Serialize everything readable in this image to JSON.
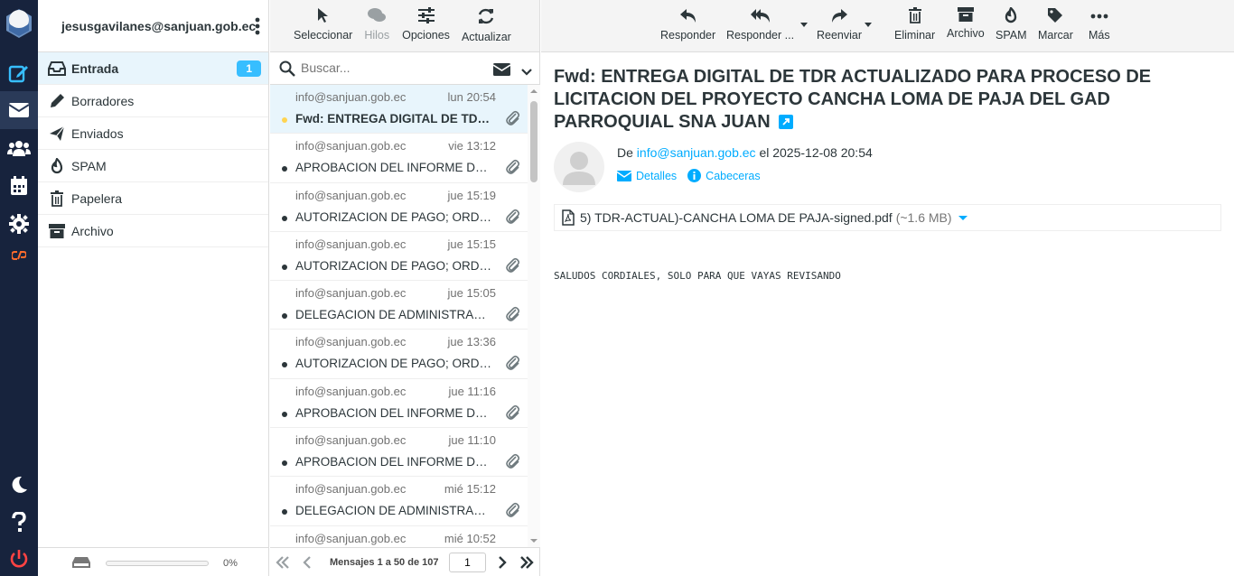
{
  "account": {
    "email": "jesusgavilanes@sanjuan.gob.ec"
  },
  "folders": [
    {
      "label": "Entrada",
      "badge": "1"
    },
    {
      "label": "Borradores"
    },
    {
      "label": "Enviados"
    },
    {
      "label": "SPAM"
    },
    {
      "label": "Papelera"
    },
    {
      "label": "Archivo"
    }
  ],
  "quota": {
    "percent_label": "0%",
    "percent": 0
  },
  "list_toolbar": {
    "select": "Seleccionar",
    "threads": "Hilos",
    "options": "Opciones",
    "refresh": "Actualizar"
  },
  "search": {
    "placeholder": "Buscar..."
  },
  "messages": [
    {
      "from": "info@sanjuan.gob.ec",
      "date": "lun 20:54",
      "subject": "Fwd: ENTREGA DIGITAL DE TDR ACTUALIZADO PARA PROCESO DE LICITACION"
    },
    {
      "from": "info@sanjuan.gob.ec",
      "date": "vie 13:12",
      "subject": "APROBACION DEL INFORME DE NECESIDAD"
    },
    {
      "from": "info@sanjuan.gob.ec",
      "date": "jue 15:19",
      "subject": "AUTORIZACION DE PAGO; ORDEN DE PAGO"
    },
    {
      "from": "info@sanjuan.gob.ec",
      "date": "jue 15:15",
      "subject": "AUTORIZACION DE PAGO; ORDEN DE PAGO"
    },
    {
      "from": "info@sanjuan.gob.ec",
      "date": "jue 15:05",
      "subject": "DELEGACION DE ADMINISTRADOR DE CONTRATO"
    },
    {
      "from": "info@sanjuan.gob.ec",
      "date": "jue 13:36",
      "subject": "AUTORIZACION DE PAGO; ORDEN DE PAGO"
    },
    {
      "from": "info@sanjuan.gob.ec",
      "date": "jue 11:16",
      "subject": "APROBACION DEL INFORME DE NECESIDAD"
    },
    {
      "from": "info@sanjuan.gob.ec",
      "date": "jue 11:10",
      "subject": "APROBACION DEL INFORME DE NECESIDAD"
    },
    {
      "from": "info@sanjuan.gob.ec",
      "date": "mié 15:12",
      "subject": "DELEGACION DE ADMINISTRADOR DE CONTRATO"
    },
    {
      "from": "info@sanjuan.gob.ec",
      "date": "mié 10:52",
      "subject": ""
    }
  ],
  "pager": {
    "count": "Mensajes 1 a 50 de 107",
    "page": "1"
  },
  "preview_toolbar": {
    "reply": "Responder",
    "reply_all": "Responder ...",
    "forward": "Reenviar",
    "delete": "Eliminar",
    "archive": "Archivo",
    "spam": "SPAM",
    "mark": "Marcar",
    "more": "Más"
  },
  "email": {
    "subject": "Fwd: ENTREGA DIGITAL DE TDR ACTUALIZADO PARA PROCESO DE LICITACION DEL PROYECTO CANCHA LOMA DE PAJA DEL GAD PARROQUIAL SNA JUAN",
    "from_prefix": "De",
    "from": "info@sanjuan.gob.ec",
    "date_prefix": "el",
    "date": "2025-12-08 20:54",
    "details_label": "Detalles",
    "headers_label": "Cabeceras",
    "attachment_name": "5) TDR-ACTUAL)-CANCHA LOMA DE PAJA-signed.pdf",
    "attachment_size": "(~1.6 MB)",
    "body": "SALUDOS CORDIALES, SOLO PARA QUE VAYAS REVISANDO"
  },
  "colors": {
    "rail": "#17233d",
    "accent": "#37beff",
    "link": "#00acff",
    "selected_row": "#e8f5fc",
    "unread_dot": "#ffd452"
  }
}
